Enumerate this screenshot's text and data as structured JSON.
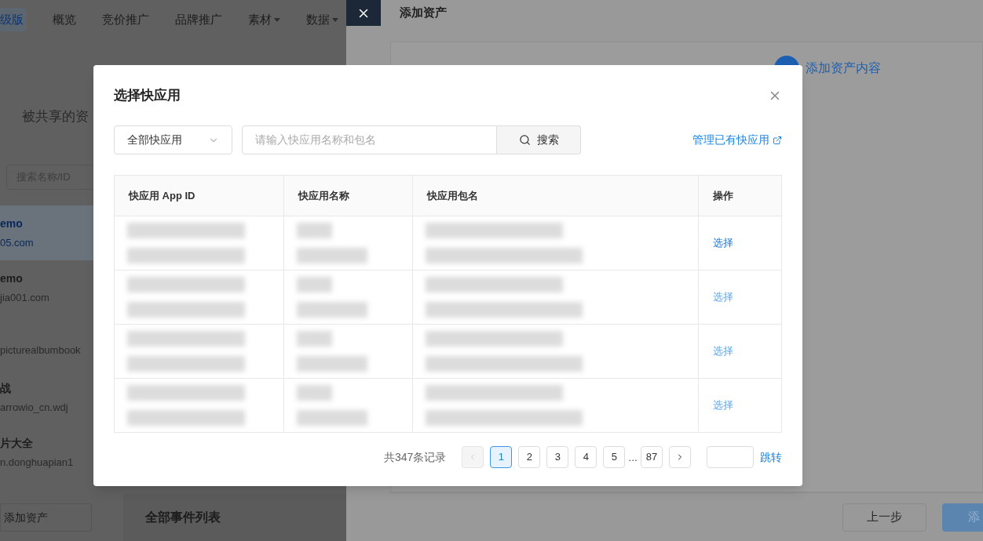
{
  "top_nav": {
    "badge": "级版",
    "items": [
      {
        "label": "概览",
        "dropdown": false
      },
      {
        "label": "竞价推广",
        "dropdown": false
      },
      {
        "label": "品牌推广",
        "dropdown": false
      },
      {
        "label": "素材",
        "dropdown": true
      },
      {
        "label": "数据",
        "dropdown": true
      }
    ]
  },
  "left_panel": {
    "title": "被共享的资",
    "search_placeholder": "搜索名称/ID",
    "items": [
      {
        "name": "emo",
        "account": "05.com",
        "selected": true
      },
      {
        "name": "emo",
        "account": "jia001.com",
        "selected": false
      },
      {
        "account": "picturealbumbook",
        "selected": false
      },
      {
        "name": "战",
        "account": "arrowio_cn.wdj",
        "selected": false
      },
      {
        "name": "片大全",
        "account": "n.donghuapian1",
        "selected": false
      }
    ],
    "add_button": "添加资产",
    "events_title": "全部事件列表"
  },
  "drawer": {
    "title": "添加资产",
    "step": {
      "title": "添加资产内容"
    },
    "back_button": "上一步",
    "next_button": "添"
  },
  "modal": {
    "title": "选择快应用",
    "filter": {
      "value": "全部快应用"
    },
    "search": {
      "placeholder": "请输入快应用名称和包名",
      "button": "搜索"
    },
    "manage_link": "管理已有快应用",
    "table": {
      "columns": [
        "快应用 App ID",
        "快应用名称",
        "快应用包名",
        "操作"
      ],
      "rows": [
        {
          "action": "选择",
          "active": true
        },
        {
          "action": "选择",
          "active": false
        },
        {
          "action": "选择",
          "active": false
        },
        {
          "action": "选择",
          "active": false
        }
      ]
    },
    "pagination": {
      "total": "共347条记录",
      "prev_disabled": true,
      "pages": [
        {
          "label": "1",
          "selected": true
        },
        {
          "label": "2",
          "selected": false
        },
        {
          "label": "3",
          "selected": false
        },
        {
          "label": "4",
          "selected": false
        },
        {
          "label": "5",
          "selected": false
        },
        {
          "label": "...",
          "kind": "ellipsis"
        },
        {
          "label": "87",
          "selected": false
        }
      ],
      "jump_button": "跳转"
    }
  }
}
